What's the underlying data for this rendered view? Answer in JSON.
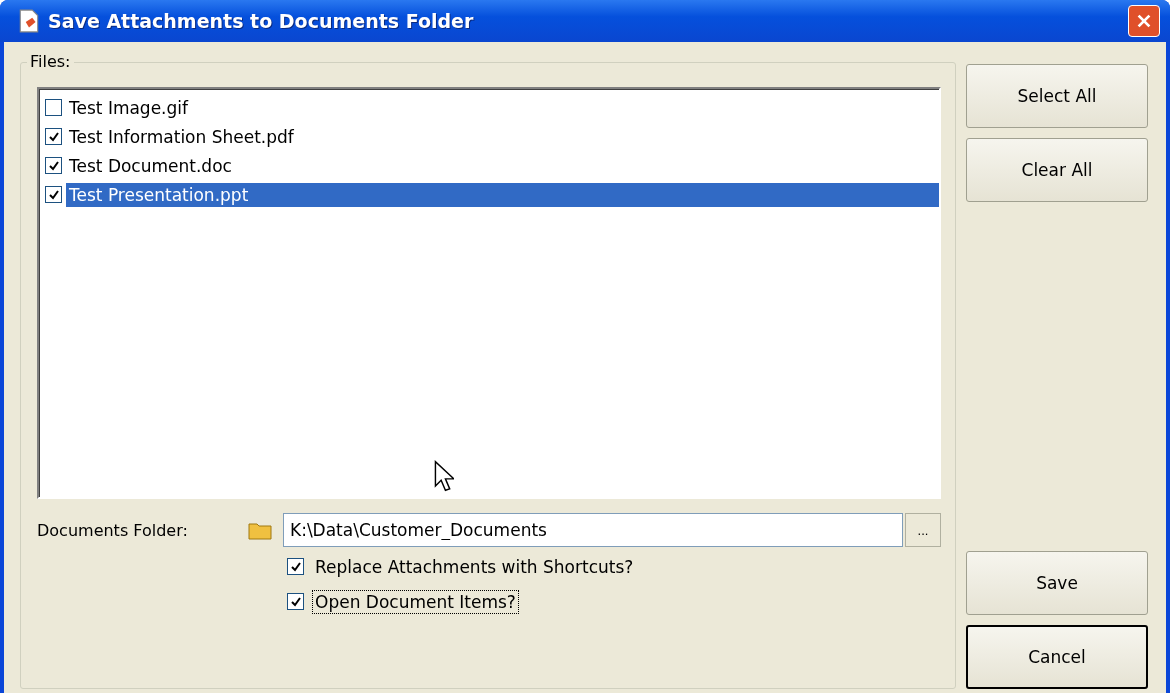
{
  "window": {
    "title": "Save Attachments to Documents Folder"
  },
  "files": {
    "legend": "Files:",
    "items": [
      {
        "name": "Test Image.gif",
        "checked": false,
        "selected": false
      },
      {
        "name": "Test Information Sheet.pdf",
        "checked": true,
        "selected": false
      },
      {
        "name": "Test Document.doc",
        "checked": true,
        "selected": false
      },
      {
        "name": "Test Presentation.ppt",
        "checked": true,
        "selected": true
      }
    ]
  },
  "folder": {
    "label": "Documents Folder:",
    "value": "K:\\Data\\Customer_Documents",
    "browse": "..."
  },
  "options": [
    {
      "label": "Replace Attachments with Shortcuts?",
      "checked": true,
      "focused": false
    },
    {
      "label": "Open Document Items?",
      "checked": true,
      "focused": true
    }
  ],
  "buttons": {
    "top": [
      {
        "label": "Select All",
        "default": false
      },
      {
        "label": "Clear All",
        "default": false
      }
    ],
    "bottom": [
      {
        "label": "Save",
        "default": false
      },
      {
        "label": "Cancel",
        "default": true
      }
    ]
  }
}
